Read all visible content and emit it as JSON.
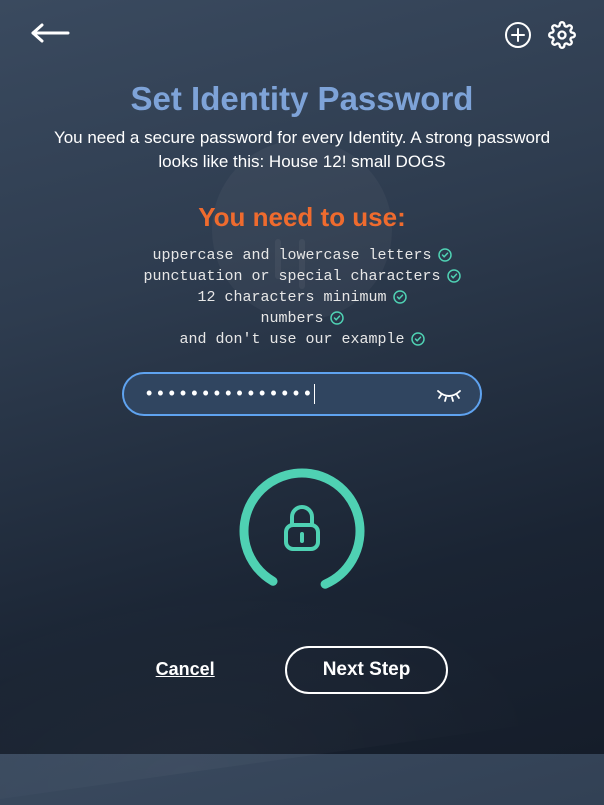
{
  "header": {
    "back": "Back",
    "add": "Add",
    "settings": "Settings"
  },
  "title": "Set Identity Password",
  "subtitle": "You need a secure password for every Identity. A strong password looks like this:  House 12! small DOGS",
  "requirements": {
    "heading": "You need to use:",
    "items": [
      "uppercase and lowercase letters",
      "punctuation or special characters",
      "12 characters minimum",
      "numbers",
      "and don't use our example"
    ]
  },
  "password": {
    "masked": "•••••••••••••••",
    "visibility_toggle": "Toggle visibility"
  },
  "buttons": {
    "cancel": "Cancel",
    "next": "Next Step"
  },
  "colors": {
    "accent_blue": "#7ea3d8",
    "accent_orange": "#ef6b2e",
    "accent_teal": "#4fd1b3"
  }
}
